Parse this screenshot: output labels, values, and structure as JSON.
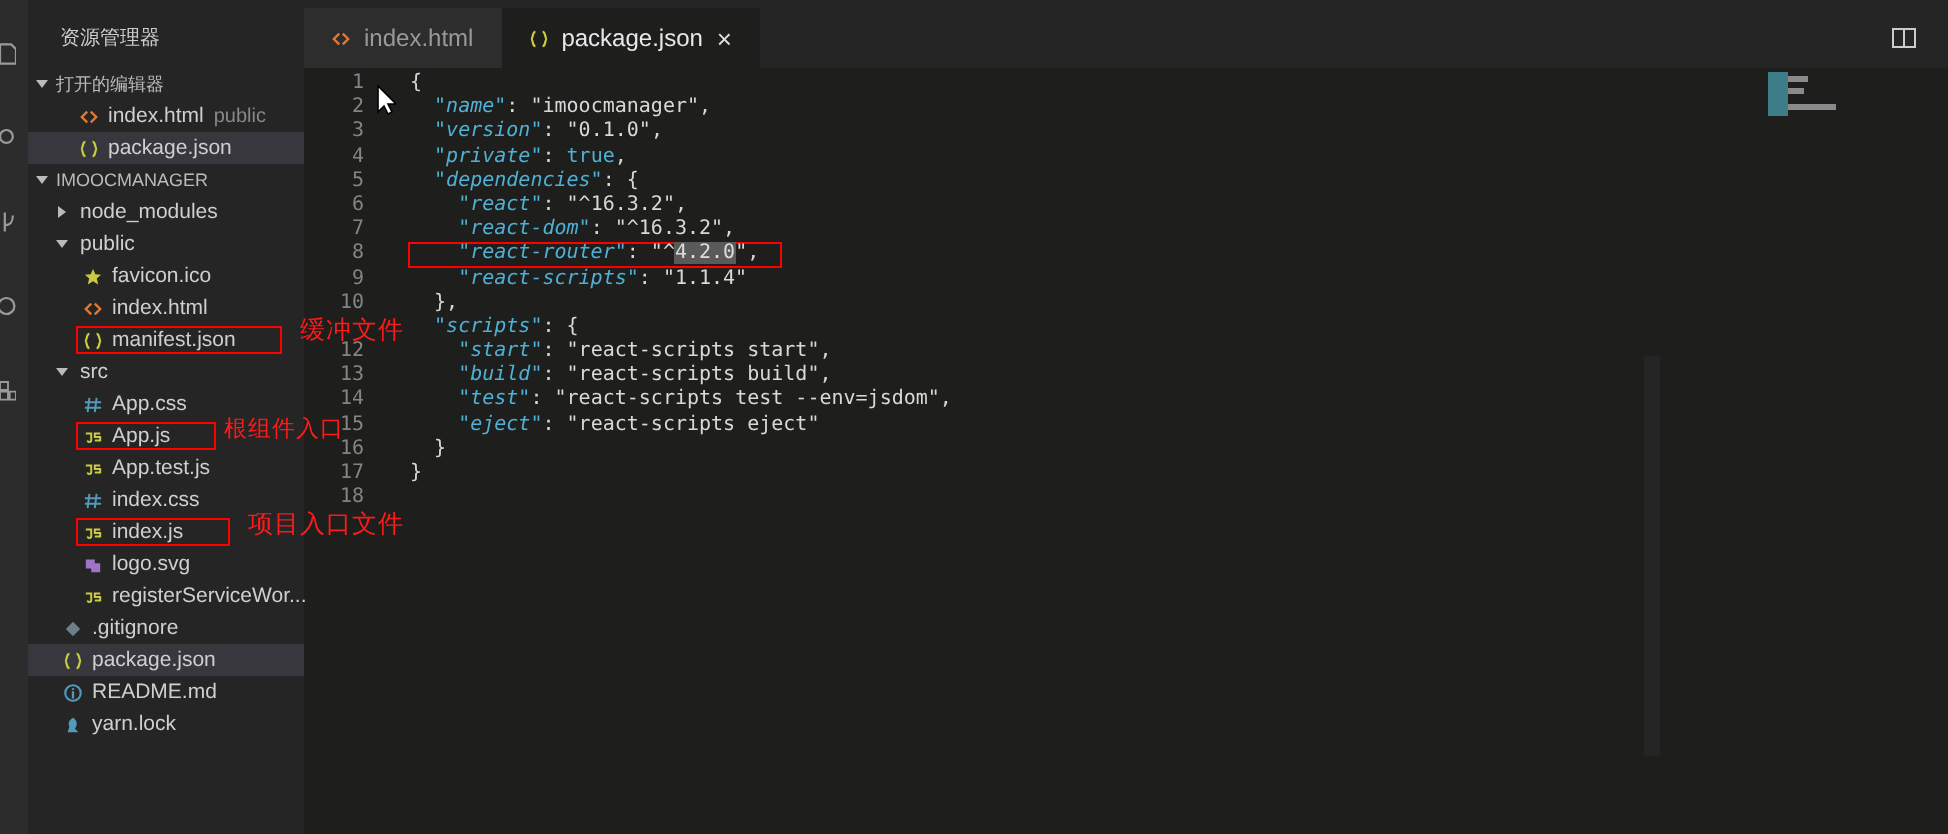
{
  "sidebar": {
    "title": "资源管理器",
    "open_editors": {
      "title": "打开的编辑器",
      "expanded": true,
      "items": [
        {
          "name": "index.html",
          "kind": "html",
          "description": "public",
          "selected": false
        },
        {
          "name": "package.json",
          "kind": "json",
          "selected": true
        }
      ]
    },
    "project": {
      "title": "IMOOCMANAGER",
      "expanded": true,
      "items": [
        {
          "name": "node_modules",
          "kind": "folder",
          "expanded": false,
          "selected": false
        },
        {
          "name": "public",
          "kind": "folder",
          "expanded": true,
          "selected": false,
          "children": [
            {
              "name": "favicon.ico",
              "kind": "star",
              "selected": false
            },
            {
              "name": "index.html",
              "kind": "html",
              "selected": false
            },
            {
              "name": "manifest.json",
              "kind": "json",
              "selected": false,
              "boxed": true,
              "note": "缓冲文件"
            }
          ]
        },
        {
          "name": "src",
          "kind": "folder",
          "expanded": true,
          "selected": false,
          "children": [
            {
              "name": "App.css",
              "kind": "css",
              "selected": false
            },
            {
              "name": "App.js",
              "kind": "js",
              "selected": false,
              "boxed": true,
              "note": "根组件入口"
            },
            {
              "name": "App.test.js",
              "kind": "js",
              "selected": false
            },
            {
              "name": "index.css",
              "kind": "css",
              "selected": false
            },
            {
              "name": "index.js",
              "kind": "js",
              "selected": false,
              "boxed": true,
              "note": "项目入口文件"
            },
            {
              "name": "logo.svg",
              "kind": "svg",
              "selected": false
            },
            {
              "name": "registerServiceWor...",
              "kind": "js",
              "selected": false
            }
          ]
        },
        {
          "name": ".gitignore",
          "kind": "git",
          "selected": false
        },
        {
          "name": "package.json",
          "kind": "json",
          "selected": true
        },
        {
          "name": "README.md",
          "kind": "info",
          "selected": false
        },
        {
          "name": "yarn.lock",
          "kind": "yarn",
          "selected": false
        }
      ]
    }
  },
  "tabs": [
    {
      "label": "index.html",
      "kind": "html",
      "selected": false
    },
    {
      "label": "package.json",
      "kind": "json",
      "selected": true,
      "close": "×"
    }
  ],
  "editor": {
    "lines": [
      {
        "n": "1",
        "parts": [
          {
            "kind": "punct",
            "text": "{"
          }
        ]
      },
      {
        "n": "2",
        "parts": [
          {
            "kind": "key",
            "text": "  \"name\""
          },
          {
            "kind": "punct",
            "text": ": "
          },
          {
            "kind": "string",
            "text": "\"imoocmanager\""
          },
          {
            "kind": "punct",
            "text": ","
          }
        ]
      },
      {
        "n": "3",
        "parts": [
          {
            "kind": "key",
            "text": "  \"version\""
          },
          {
            "kind": "punct",
            "text": ": "
          },
          {
            "kind": "string",
            "text": "\"0.1.0\""
          },
          {
            "kind": "punct",
            "text": ","
          }
        ]
      },
      {
        "n": "4",
        "parts": [
          {
            "kind": "key",
            "text": "  \"private\""
          },
          {
            "kind": "punct",
            "text": ": "
          },
          {
            "kind": "bool",
            "text": "true"
          },
          {
            "kind": "punct",
            "text": ","
          }
        ]
      },
      {
        "n": "5",
        "parts": [
          {
            "kind": "key",
            "text": "  \"dependencies\""
          },
          {
            "kind": "punct",
            "text": ": {"
          }
        ]
      },
      {
        "n": "6",
        "parts": [
          {
            "kind": "key",
            "text": "    \"react\""
          },
          {
            "kind": "punct",
            "text": ": "
          },
          {
            "kind": "string",
            "text": "\"^16.3.2\""
          },
          {
            "kind": "punct",
            "text": ","
          }
        ]
      },
      {
        "n": "7",
        "parts": [
          {
            "kind": "key",
            "text": "    \"react-dom\""
          },
          {
            "kind": "punct",
            "text": ": "
          },
          {
            "kind": "string",
            "text": "\"^16.3.2\""
          },
          {
            "kind": "punct",
            "text": ","
          }
        ]
      },
      {
        "n": "8",
        "boxed": true,
        "parts": [
          {
            "kind": "key",
            "text": "    \"react-router\""
          },
          {
            "kind": "punct",
            "text": ": "
          },
          {
            "kind": "string",
            "text": "\"^"
          },
          {
            "kind": "selected",
            "text": "4.2.0"
          },
          {
            "kind": "string",
            "text": "\""
          },
          {
            "kind": "punct",
            "text": ","
          }
        ]
      },
      {
        "n": "9",
        "parts": [
          {
            "kind": "key",
            "text": "    \"react-scripts\""
          },
          {
            "kind": "punct",
            "text": ": "
          },
          {
            "kind": "string",
            "text": "\"1.1.4\""
          }
        ]
      },
      {
        "n": "10",
        "parts": [
          {
            "kind": "punct",
            "text": "  },"
          }
        ]
      },
      {
        "parts": [
          {
            "kind": "key",
            "text": "  \"scripts\""
          },
          {
            "kind": "punct",
            "text": ": {"
          }
        ]
      },
      {
        "n": "12",
        "parts": [
          {
            "kind": "key",
            "text": "    \"start\""
          },
          {
            "kind": "punct",
            "text": ": "
          },
          {
            "kind": "string",
            "text": "\"react-scripts start\""
          },
          {
            "kind": "punct",
            "text": ","
          }
        ]
      },
      {
        "n": "13",
        "parts": [
          {
            "kind": "key",
            "text": "    \"build\""
          },
          {
            "kind": "punct",
            "text": ": "
          },
          {
            "kind": "string",
            "text": "\"react-scripts build\""
          },
          {
            "kind": "punct",
            "text": ","
          }
        ]
      },
      {
        "n": "14",
        "parts": [
          {
            "kind": "key",
            "text": "    \"test\""
          },
          {
            "kind": "punct",
            "text": ": "
          },
          {
            "kind": "string",
            "text": "\"react-scripts test --env=jsdom\""
          },
          {
            "kind": "punct",
            "text": ","
          }
        ]
      },
      {
        "n": "15",
        "parts": [
          {
            "kind": "key",
            "text": "    \"eject\""
          },
          {
            "kind": "punct",
            "text": ": "
          },
          {
            "kind": "string",
            "text": "\"react-scripts eject\""
          }
        ]
      },
      {
        "n": "16",
        "parts": [
          {
            "kind": "punct",
            "text": "  }"
          }
        ]
      },
      {
        "n": "17",
        "parts": [
          {
            "kind": "punct",
            "text": "}"
          }
        ]
      },
      {
        "n": "18"
      }
    ]
  }
}
